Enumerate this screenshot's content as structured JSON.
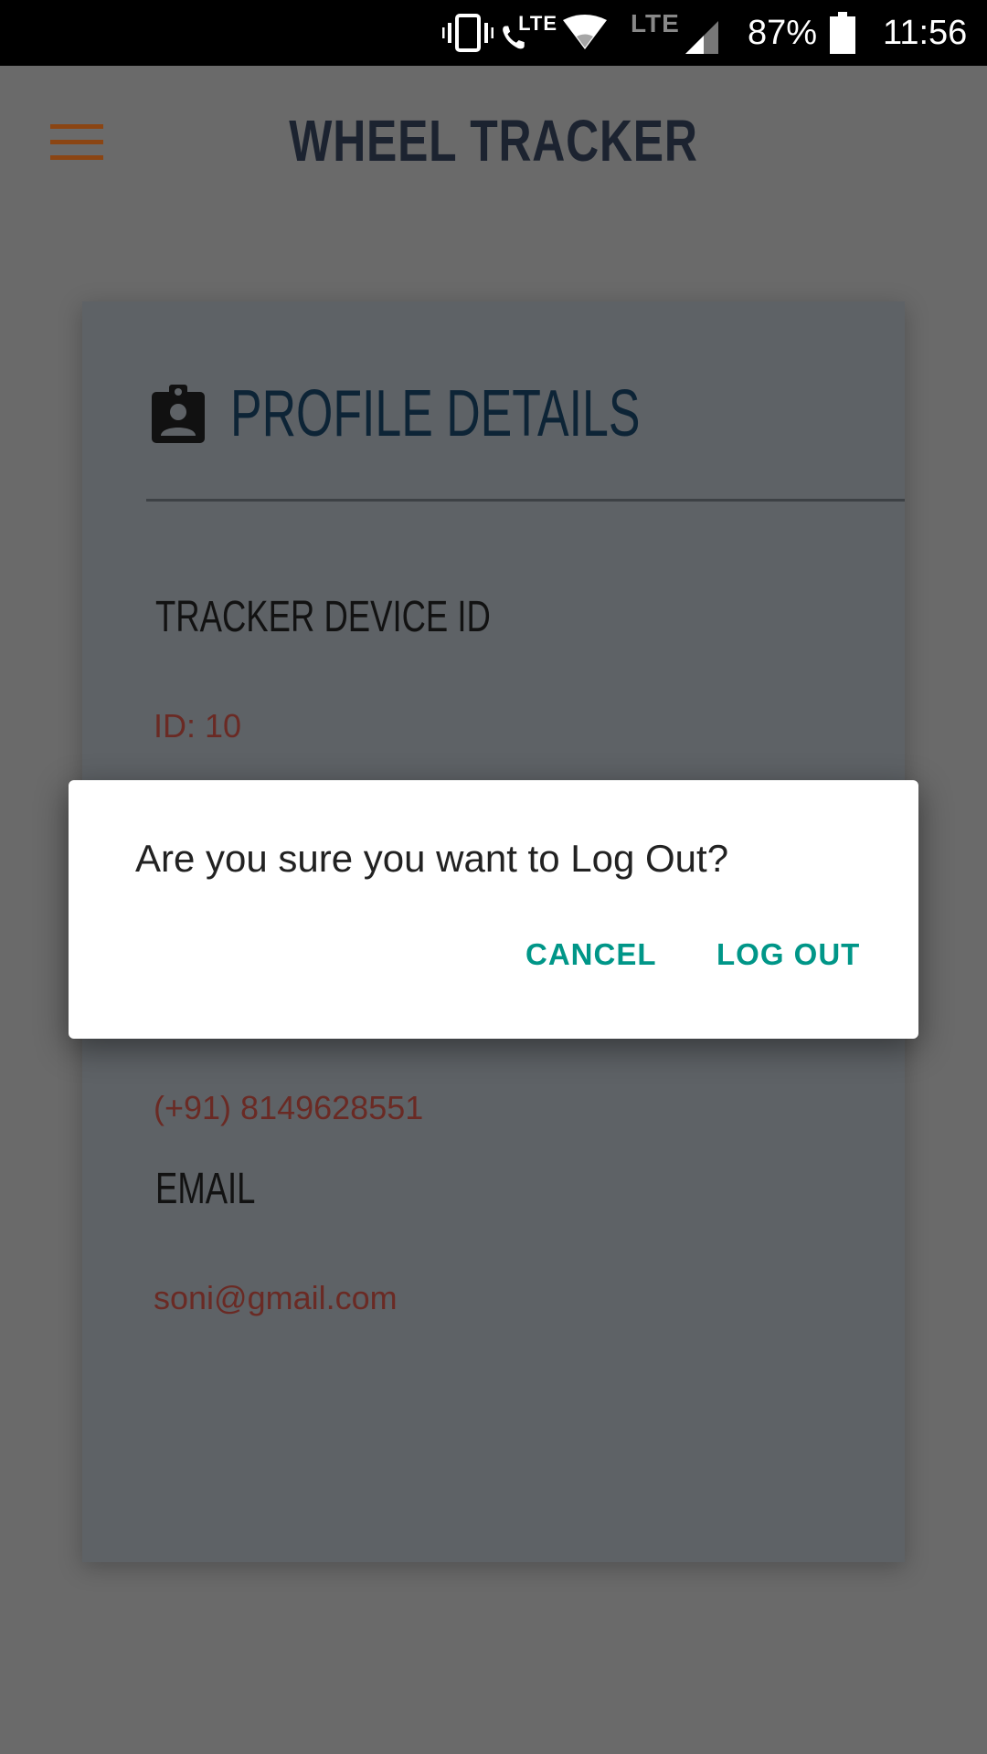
{
  "status_bar": {
    "lte_small": "LTE",
    "lte_large": "LTE",
    "battery": "87%",
    "time": "11:56",
    "icons": [
      "vibrate-icon",
      "wifi-calling-icon",
      "wifi-icon",
      "cellular-signal-icon",
      "battery-icon"
    ]
  },
  "app_bar": {
    "title": "WHEEL TRACKER",
    "menu_icon": "hamburger-menu-icon",
    "accent_color": "#8b4513"
  },
  "profile_card": {
    "title": "PROFILE DETAILS",
    "icon": "assignment-ind-icon",
    "fields": [
      {
        "label": "TRACKER DEVICE ID",
        "value": "ID: 10"
      },
      {
        "label": "",
        "value": "(+91) 8149628551"
      },
      {
        "label": "EMAIL",
        "value": "soni@gmail.com"
      }
    ]
  },
  "dialog": {
    "message": "Are you sure you want to Log Out?",
    "cancel_label": "CANCEL",
    "confirm_label": "LOG OUT",
    "button_color": "#009688"
  }
}
